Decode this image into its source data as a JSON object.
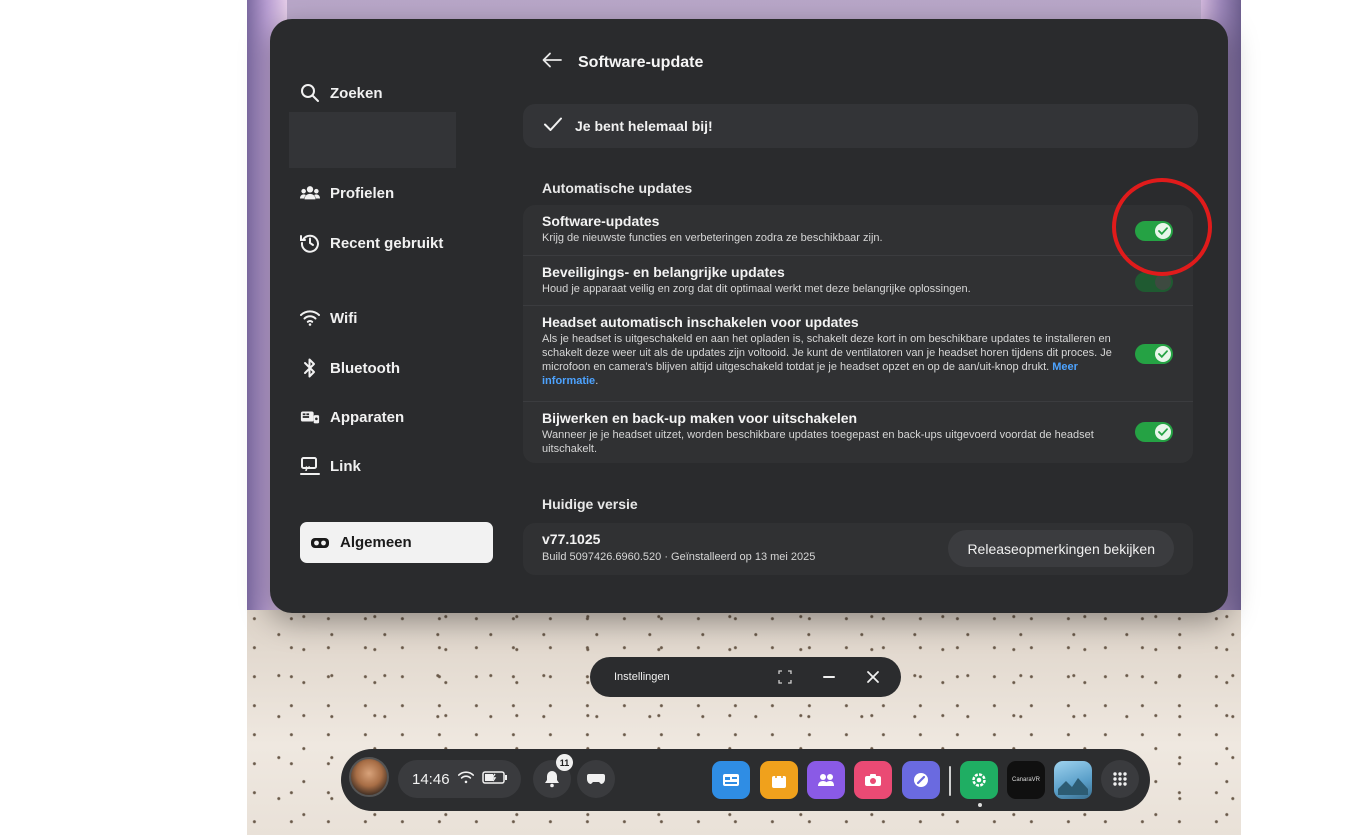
{
  "sidebar": {
    "search": "Zoeken",
    "items": [
      {
        "label": "Profielen"
      },
      {
        "label": "Recent gebruikt"
      },
      {
        "label": "Wifi"
      },
      {
        "label": "Bluetooth"
      },
      {
        "label": "Apparaten"
      },
      {
        "label": "Link"
      },
      {
        "label": "Algemeen"
      }
    ]
  },
  "header": {
    "title": "Software-update"
  },
  "status": {
    "text": "Je bent helemaal bij!"
  },
  "auto_updates": {
    "section_title": "Automatische updates",
    "rows": [
      {
        "title": "Software-updates",
        "desc": "Krijg de nieuwste functies en verbeteringen zodra ze beschikbaar zijn.",
        "enabled": true
      },
      {
        "title": "Beveiligings- en belangrijke updates",
        "desc": "Houd je apparaat veilig en zorg dat dit optimaal werkt met deze belangrijke oplossingen.",
        "enabled": true
      },
      {
        "title": "Headset automatisch inschakelen voor updates",
        "desc": "Als je headset is uitgeschakeld en aan het opladen is, schakelt deze kort in om beschikbare updates te installeren en schakelt deze weer uit als de updates zijn voltooid. Je kunt de ventilatoren van je headset horen tijdens dit proces. Je microfoon en camera's blijven altijd uitgeschakeld totdat je je headset opzet en op de aan/uit-knop drukt.",
        "link": "Meer informatie",
        "enabled": true
      },
      {
        "title": "Bijwerken en back-up maken voor uitschakelen",
        "desc": "Wanneer je je headset uitzet, worden beschikbare updates toegepast en back-ups uitgevoerd voordat de headset uitschakelt.",
        "enabled": true
      }
    ]
  },
  "version": {
    "section_title": "Huidige versie",
    "number": "v77.1025",
    "build": "Build 5097426.6960.520 · Geïnstalleerd op 13 mei 2025",
    "release_notes_button": "Releaseopmerkingen bekijken"
  },
  "window_bar": {
    "title": "Instellingen"
  },
  "taskbar": {
    "time": "14:46",
    "notification_count": "11",
    "app_tile_text": "CanaraVR"
  },
  "colors": {
    "toggle_on": "#25a244",
    "link": "#4da3ff",
    "highlight_circle": "#e01b1b"
  }
}
